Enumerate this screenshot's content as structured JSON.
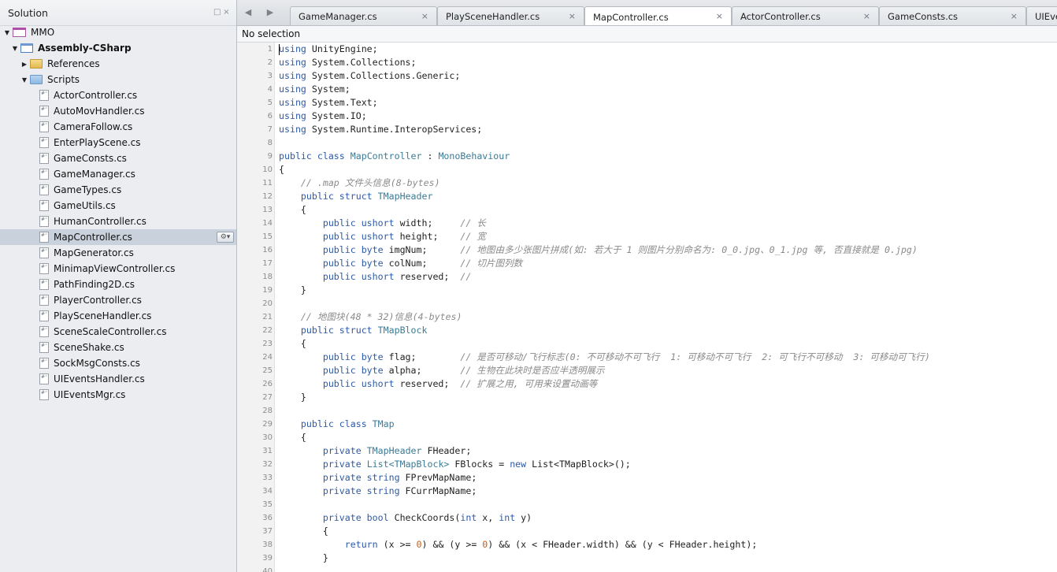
{
  "sidebar": {
    "title": "Solution",
    "tree": [
      {
        "label": "MMO",
        "icon": "solution-icon",
        "depth": 0,
        "expanded": true,
        "bold": false
      },
      {
        "label": "Assembly-CSharp",
        "icon": "project-icon",
        "depth": 1,
        "expanded": true,
        "bold": true
      },
      {
        "label": "References",
        "icon": "references-folder-icon",
        "depth": 2,
        "expanded": false,
        "bold": false
      },
      {
        "label": "Scripts",
        "icon": "folder-icon",
        "depth": 2,
        "expanded": true,
        "bold": false
      },
      {
        "label": "ActorController.cs",
        "icon": "cs-file-icon",
        "depth": 3
      },
      {
        "label": "AutoMovHandler.cs",
        "icon": "cs-file-icon",
        "depth": 3
      },
      {
        "label": "CameraFollow.cs",
        "icon": "cs-file-icon",
        "depth": 3
      },
      {
        "label": "EnterPlayScene.cs",
        "icon": "cs-file-icon",
        "depth": 3
      },
      {
        "label": "GameConsts.cs",
        "icon": "cs-file-icon",
        "depth": 3
      },
      {
        "label": "GameManager.cs",
        "icon": "cs-file-icon",
        "depth": 3
      },
      {
        "label": "GameTypes.cs",
        "icon": "cs-file-icon",
        "depth": 3
      },
      {
        "label": "GameUtils.cs",
        "icon": "cs-file-icon",
        "depth": 3
      },
      {
        "label": "HumanController.cs",
        "icon": "cs-file-icon",
        "depth": 3
      },
      {
        "label": "MapController.cs",
        "icon": "cs-file-icon",
        "depth": 3,
        "selected": true
      },
      {
        "label": "MapGenerator.cs",
        "icon": "cs-file-icon",
        "depth": 3
      },
      {
        "label": "MinimapViewController.cs",
        "icon": "cs-file-icon",
        "depth": 3
      },
      {
        "label": "PathFinding2D.cs",
        "icon": "cs-file-icon",
        "depth": 3
      },
      {
        "label": "PlayerController.cs",
        "icon": "cs-file-icon",
        "depth": 3
      },
      {
        "label": "PlaySceneHandler.cs",
        "icon": "cs-file-icon",
        "depth": 3
      },
      {
        "label": "SceneScaleController.cs",
        "icon": "cs-file-icon",
        "depth": 3
      },
      {
        "label": "SceneShake.cs",
        "icon": "cs-file-icon",
        "depth": 3
      },
      {
        "label": "SockMsgConsts.cs",
        "icon": "cs-file-icon",
        "depth": 3
      },
      {
        "label": "UIEventsHandler.cs",
        "icon": "cs-file-icon",
        "depth": 3
      },
      {
        "label": "UIEventsMgr.cs",
        "icon": "cs-file-icon",
        "depth": 3
      }
    ]
  },
  "tabs": [
    {
      "label": "GameManager.cs",
      "active": false
    },
    {
      "label": "PlaySceneHandler.cs",
      "active": false
    },
    {
      "label": "MapController.cs",
      "active": true
    },
    {
      "label": "ActorController.cs",
      "active": false
    },
    {
      "label": "GameConsts.cs",
      "active": false
    },
    {
      "label": "UIEve",
      "active": false
    }
  ],
  "editor": {
    "selection_label": "No selection",
    "lines": [
      [
        [
          "k",
          "using"
        ],
        [
          "p",
          " UnityEngine;"
        ]
      ],
      [
        [
          "k",
          "using"
        ],
        [
          "p",
          " System.Collections;"
        ]
      ],
      [
        [
          "k",
          "using"
        ],
        [
          "p",
          " System.Collections.Generic;"
        ]
      ],
      [
        [
          "k",
          "using"
        ],
        [
          "p",
          " System;"
        ]
      ],
      [
        [
          "k",
          "using"
        ],
        [
          "p",
          " System.Text;"
        ]
      ],
      [
        [
          "k",
          "using"
        ],
        [
          "p",
          " System.IO;"
        ]
      ],
      [
        [
          "k",
          "using"
        ],
        [
          "p",
          " System.Runtime.InteropServices;"
        ]
      ],
      [],
      [
        [
          "k",
          "public class"
        ],
        [
          "p",
          " "
        ],
        [
          "t",
          "MapController"
        ],
        [
          "p",
          " : "
        ],
        [
          "t",
          "MonoBehaviour"
        ]
      ],
      [
        [
          "p",
          "{"
        ]
      ],
      [
        [
          "p",
          "    "
        ],
        [
          "c",
          "// .map 文件头信息(8-bytes)"
        ]
      ],
      [
        [
          "p",
          "    "
        ],
        [
          "k",
          "public struct"
        ],
        [
          "p",
          " "
        ],
        [
          "t",
          "TMapHeader"
        ]
      ],
      [
        [
          "p",
          "    {"
        ]
      ],
      [
        [
          "p",
          "        "
        ],
        [
          "k",
          "public ushort"
        ],
        [
          "p",
          " width;     "
        ],
        [
          "c",
          "// 长"
        ]
      ],
      [
        [
          "p",
          "        "
        ],
        [
          "k",
          "public ushort"
        ],
        [
          "p",
          " height;    "
        ],
        [
          "c",
          "// 宽"
        ]
      ],
      [
        [
          "p",
          "        "
        ],
        [
          "k",
          "public byte"
        ],
        [
          "p",
          " imgNum;      "
        ],
        [
          "c",
          "// 地图由多少张图片拼成(如: 若大于 1 则图片分别命名为: 0_0.jpg、0_1.jpg 等, 否直接就是 0.jpg)"
        ]
      ],
      [
        [
          "p",
          "        "
        ],
        [
          "k",
          "public byte"
        ],
        [
          "p",
          " colNum;      "
        ],
        [
          "c",
          "// 切片图列数"
        ]
      ],
      [
        [
          "p",
          "        "
        ],
        [
          "k",
          "public ushort"
        ],
        [
          "p",
          " reserved;  "
        ],
        [
          "c",
          "//"
        ]
      ],
      [
        [
          "p",
          "    }"
        ]
      ],
      [],
      [
        [
          "p",
          "    "
        ],
        [
          "c",
          "// 地图块(48 * 32)信息(4-bytes)"
        ]
      ],
      [
        [
          "p",
          "    "
        ],
        [
          "k",
          "public struct"
        ],
        [
          "p",
          " "
        ],
        [
          "t",
          "TMapBlock"
        ]
      ],
      [
        [
          "p",
          "    {"
        ]
      ],
      [
        [
          "p",
          "        "
        ],
        [
          "k",
          "public byte"
        ],
        [
          "p",
          " flag;        "
        ],
        [
          "c",
          "// 是否可移动/飞行标志(0: 不可移动不可飞行  1: 可移动不可飞行  2: 可飞行不可移动  3: 可移动可飞行)"
        ]
      ],
      [
        [
          "p",
          "        "
        ],
        [
          "k",
          "public byte"
        ],
        [
          "p",
          " alpha;       "
        ],
        [
          "c",
          "// 生物在此块时是否应半透明展示"
        ]
      ],
      [
        [
          "p",
          "        "
        ],
        [
          "k",
          "public ushort"
        ],
        [
          "p",
          " reserved;  "
        ],
        [
          "c",
          "// 扩展之用, 可用来设置动画等"
        ]
      ],
      [
        [
          "p",
          "    }"
        ]
      ],
      [],
      [
        [
          "p",
          "    "
        ],
        [
          "k",
          "public class"
        ],
        [
          "p",
          " "
        ],
        [
          "t",
          "TMap"
        ]
      ],
      [
        [
          "p",
          "    {"
        ]
      ],
      [
        [
          "p",
          "        "
        ],
        [
          "k",
          "private"
        ],
        [
          "p",
          " "
        ],
        [
          "t",
          "TMapHeader"
        ],
        [
          "p",
          " FHeader;"
        ]
      ],
      [
        [
          "p",
          "        "
        ],
        [
          "k",
          "private"
        ],
        [
          "p",
          " "
        ],
        [
          "t",
          "List<TMapBlock>"
        ],
        [
          "p",
          " FBlocks = "
        ],
        [
          "k",
          "new"
        ],
        [
          "p",
          " List<TMapBlock>();"
        ]
      ],
      [
        [
          "p",
          "        "
        ],
        [
          "k",
          "private string"
        ],
        [
          "p",
          " FPrevMapName;"
        ]
      ],
      [
        [
          "p",
          "        "
        ],
        [
          "k",
          "private string"
        ],
        [
          "p",
          " FCurrMapName;"
        ]
      ],
      [],
      [
        [
          "p",
          "        "
        ],
        [
          "k",
          "private bool"
        ],
        [
          "p",
          " CheckCoords("
        ],
        [
          "k",
          "int"
        ],
        [
          "p",
          " x, "
        ],
        [
          "k",
          "int"
        ],
        [
          "p",
          " y)"
        ]
      ],
      [
        [
          "p",
          "        {"
        ]
      ],
      [
        [
          "p",
          "            "
        ],
        [
          "k",
          "return"
        ],
        [
          "p",
          " (x >= "
        ],
        [
          "n",
          "0"
        ],
        [
          "p",
          ") && (y >= "
        ],
        [
          "n",
          "0"
        ],
        [
          "p",
          ") && (x < FHeader.width) && (y < FHeader.height);"
        ]
      ],
      [
        [
          "p",
          "        }"
        ]
      ],
      []
    ]
  }
}
